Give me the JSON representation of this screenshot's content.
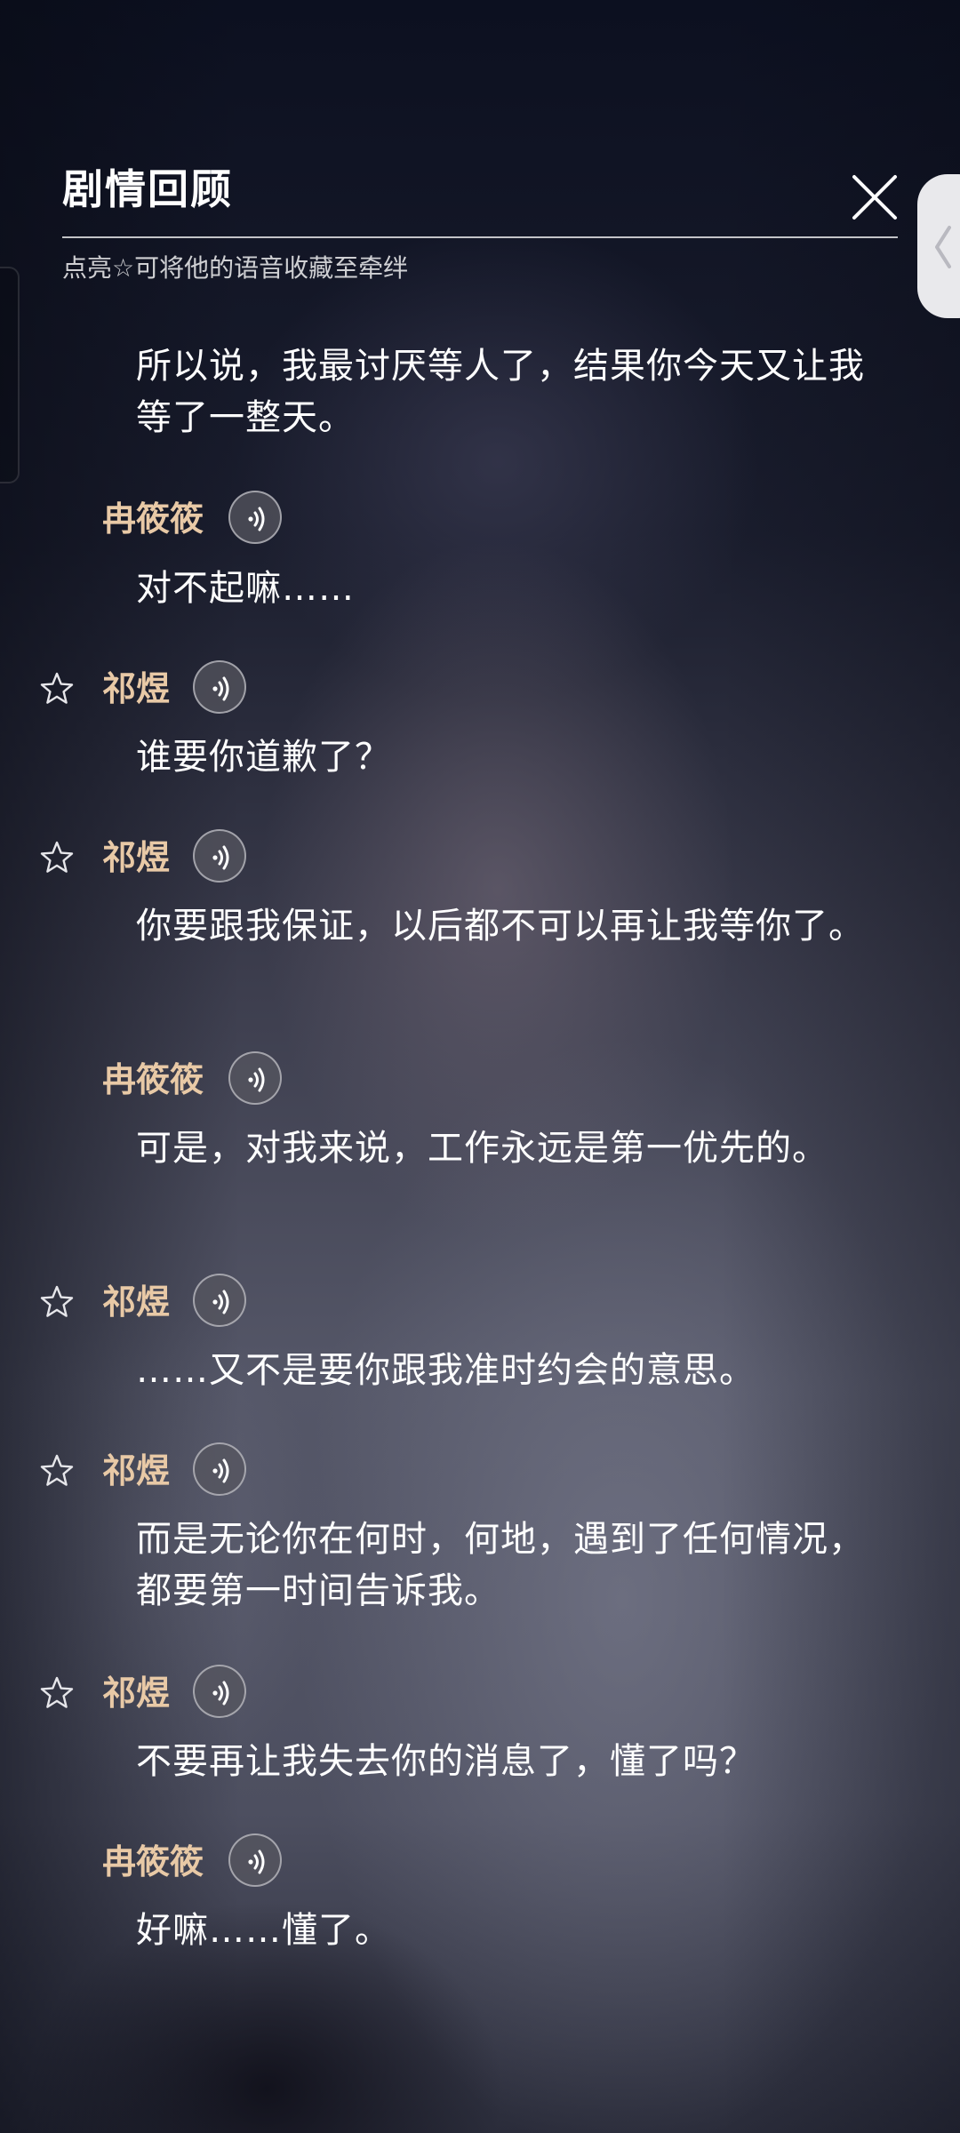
{
  "header": {
    "title": "剧情回顾",
    "subtitle": "点亮☆可将他的语音收藏至牵绊"
  },
  "icons": {
    "close": "close-icon",
    "side_tab": "chevron-left-icon",
    "star": "star-outline-icon",
    "voice": "voice-play-icon"
  },
  "colors": {
    "speaker_name": "#e8c9a6",
    "text": "#ffffff"
  },
  "dialogue": [
    {
      "speaker": "",
      "text": "所以说，我最讨厌等人了，结果你今天又让我等了一整天。",
      "favoritable": false
    },
    {
      "speaker": "冉筱筱",
      "text": "对不起嘛……",
      "favoritable": false
    },
    {
      "speaker": "祁煜",
      "text": "谁要你道歉了？",
      "favoritable": true
    },
    {
      "speaker": "祁煜",
      "text": "你要跟我保证，以后都不可以再让我等你了。",
      "favoritable": true
    },
    {
      "speaker": "冉筱筱",
      "text": "可是，对我来说，工作永远是第一优先的。",
      "favoritable": false
    },
    {
      "speaker": "祁煜",
      "text": "……又不是要你跟我准时约会的意思。",
      "favoritable": true
    },
    {
      "speaker": "祁煜",
      "text": "而是无论你在何时，何地，遇到了任何情况，都要第一时间告诉我。",
      "favoritable": true
    },
    {
      "speaker": "祁煜",
      "text": "不要再让我失去你的消息了，懂了吗？",
      "favoritable": true
    },
    {
      "speaker": "冉筱筱",
      "text": "好嘛……懂了。",
      "favoritable": false
    }
  ]
}
